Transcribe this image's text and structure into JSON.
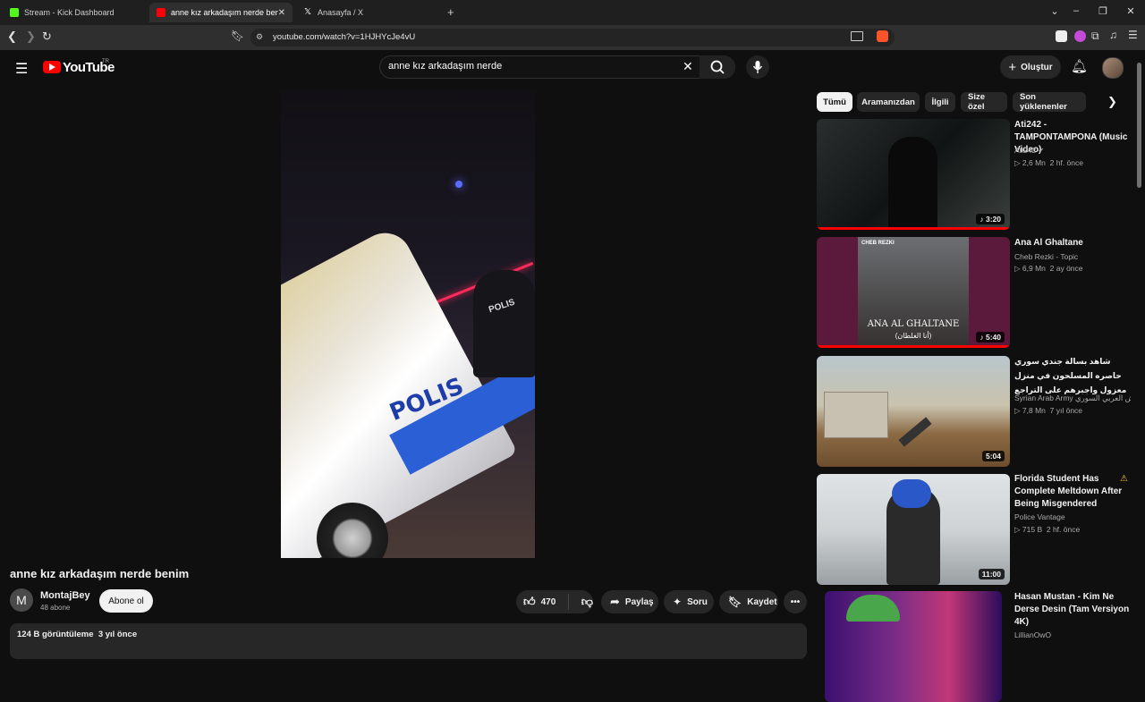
{
  "browser": {
    "tabs": [
      {
        "title": "Stream - Kick Dashboard",
        "favicon_color": "#53fc18",
        "active": false
      },
      {
        "title": "anne kız arkadaşım nerde benim",
        "favicon_color": "#ff0000",
        "active": true
      },
      {
        "title": "Anasayfa / X",
        "favicon_color": "#ffffff",
        "active": false
      }
    ],
    "url": "youtube.com/watch?v=1HJHYcJe4vU",
    "new_tab_symbol": "+"
  },
  "youtube": {
    "logo_text": "YouTube",
    "region": "TR",
    "search_query": "anne kız arkadaşım nerde",
    "create_label": "Oluştur"
  },
  "video": {
    "title": "anne kız arkadaşım nerde benim",
    "channel": "MontajBey",
    "channel_initial": "M",
    "subscribers": "48 abone",
    "subscribe_label": "Abone ol",
    "likes": "470",
    "share_label": "Paylaş",
    "ask_label": "Soru",
    "save_label": "Kaydet",
    "views": "124 B görüntüleme",
    "age": "3 yıl önce",
    "overlay_text": "POLIS",
    "overlay_text_2": "POLIS"
  },
  "chips": [
    "Tümü",
    "Aramanızdan",
    "İlgili",
    "Size özel",
    "Son yüklenenler"
  ],
  "related": [
    {
      "title": "Ati242 - TAMPONTAMPONA (Music Video)",
      "channel": "Ati242",
      "verified": true,
      "views": "2,6 Mn",
      "age": "2 hf. önce",
      "duration": "3:20",
      "music": true,
      "progress": 1.0
    },
    {
      "title": "Ana Al Ghaltane",
      "channel": "Cheb Rezki - Topic",
      "verified": false,
      "views": "6,9 Mn",
      "age": "2 ay önce",
      "duration": "5:40",
      "music": true,
      "progress": 1.0,
      "thumb_text": "ANA AL GHALTANE",
      "thumb_subtext": "(أنا الغلطان)",
      "thumb_artist": "CHEB REZKI"
    },
    {
      "title": "شاهد بسالة جندي سوري حاصره المسلحون في منزل معزول واجبرهم على التراجع",
      "channel": "Syrian Arab Army الجيش العربي السوري",
      "verified": false,
      "views": "7,8 Mn",
      "age": "7 yıl önce",
      "duration": "5:04",
      "music": false,
      "progress": 0
    },
    {
      "title": "Florida Student Has Complete Meltdown After Being Misgendered",
      "channel": "Police Vantage",
      "verified": false,
      "views": "715 B",
      "age": "2 hf. önce",
      "duration": "11:00",
      "music": false,
      "progress": 0
    },
    {
      "title": "Hasan Mustan - Kim Ne Derse Desin (Tam Versiyon 4K)",
      "channel": "LillianOwO",
      "verified": false,
      "views": "",
      "age": "",
      "duration": "",
      "music": false,
      "progress": 0
    }
  ],
  "colors": {
    "brand": "#ff0000",
    "background": "#0f0f0f",
    "surface": "#272727",
    "muted": "#aaaaaa"
  }
}
